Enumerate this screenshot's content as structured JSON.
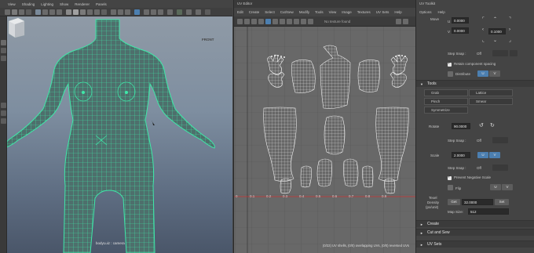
{
  "viewport": {
    "menu": [
      "View",
      "Shading",
      "Lighting",
      "Show",
      "Renderer",
      "Panels"
    ],
    "view_cube_label": "FRONT",
    "camera_label": "bodyLuiz : camera",
    "colors": {
      "wire": "#3fe7a8",
      "bg_top": "#8f9aa6",
      "bg_bottom": "#4a5669"
    }
  },
  "uv_editor": {
    "title": "UV Editor",
    "menu": [
      "Edit",
      "Create",
      "Select",
      "Cut/Sew",
      "Modify",
      "Tools",
      "View",
      "Image",
      "Textures",
      "UV Sets",
      "Help"
    ],
    "toolbar_hint": "No texture found",
    "axis_labels": [
      "0.1",
      "0.2",
      "0.3",
      "0.4",
      "0.5",
      "0.6",
      "0.7",
      "0.8",
      "0.9"
    ],
    "status": "(0/22) UV shells, (0/0) overlapping UVs, (0/0) reversed UVs"
  },
  "toolkit": {
    "title": "UV Toolkit",
    "menu": [
      "Options",
      "Help"
    ],
    "move": {
      "label": "Move",
      "u_label": "U",
      "v_label": "V",
      "u_value": "0.0000",
      "v_value": "0.0000",
      "step_value": "0.1000"
    },
    "step_snap_label": "Step Snap :",
    "step_snap_value": "Off",
    "retain_spacing": "Retain component spacing",
    "distribute_label": "Distribute",
    "u": "U",
    "v": "V",
    "tools_header": "Tools",
    "tools": [
      "Grab",
      "Lattice",
      "Pinch",
      "Smear",
      "Symmetrize"
    ],
    "rotate_label": "Rotate",
    "rotate_value": "90.0000",
    "scale_label": "Scale",
    "scale_value": "2.0000",
    "prevent_negative": "Prevent Negative Scale",
    "flip_label": "Flip",
    "texel_label_1": "Texel",
    "texel_label_2": "Density",
    "texel_label_3": "(px/unit)",
    "get_label": "Get",
    "texel_value": "32.0000",
    "set_label": "Set",
    "map_size_label": "Map Size:",
    "map_size_value": "512",
    "sections": [
      "Create",
      "Cut and Sew",
      "UV Sets"
    ]
  }
}
